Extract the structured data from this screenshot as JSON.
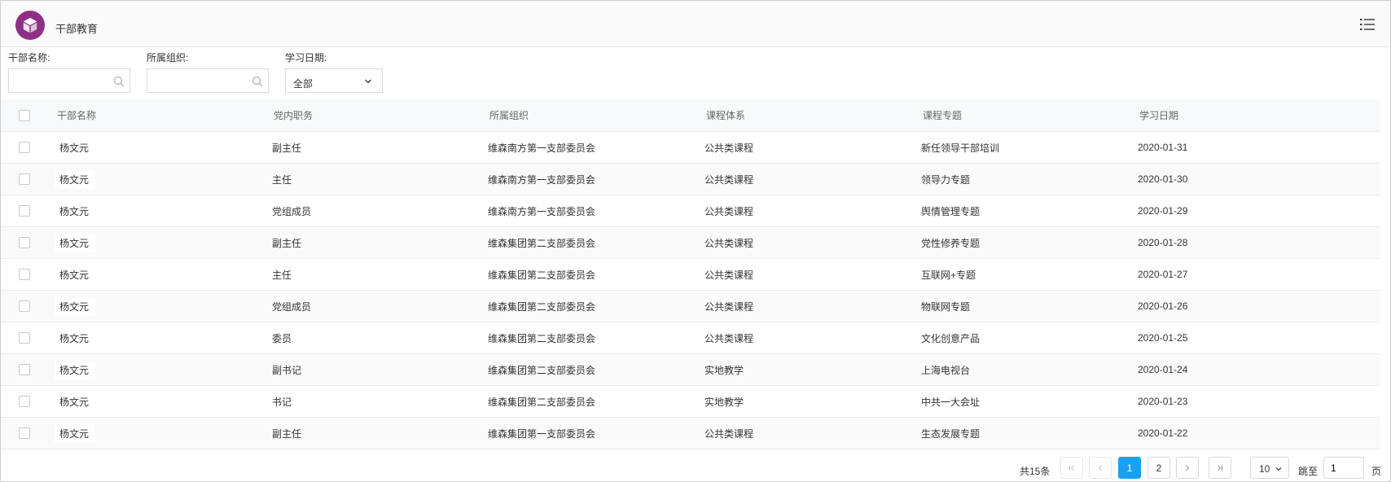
{
  "header": {
    "title": "干部教育",
    "logo_icon": "cube-icon",
    "menu_icon": "list-menu-icon",
    "logo_color": "#8e2f86"
  },
  "filters": {
    "name_label": "干部名称:",
    "name_value": "",
    "org_label": "所属组织:",
    "org_value": "",
    "date_label": "学习日期:",
    "date_selected": "全部"
  },
  "table": {
    "columns": [
      "干部名称",
      "党内职务",
      "所属组织",
      "课程体系",
      "课程专题",
      "学习日期"
    ],
    "rows": [
      [
        "杨文元",
        "副主任",
        "维森南方第一支部委员会",
        "公共类课程",
        "新任领导干部培训",
        "2020-01-31"
      ],
      [
        "杨文元",
        "主任",
        "维森南方第一支部委员会",
        "公共类课程",
        "领导力专题",
        "2020-01-30"
      ],
      [
        "杨文元",
        "党组成员",
        "维森南方第一支部委员会",
        "公共类课程",
        "舆情管理专题",
        "2020-01-29"
      ],
      [
        "杨文元",
        "副主任",
        "维森集团第二支部委员会",
        "公共类课程",
        "党性修养专题",
        "2020-01-28"
      ],
      [
        "杨文元",
        "主任",
        "维森集团第二支部委员会",
        "公共类课程",
        "互联网+专题",
        "2020-01-27"
      ],
      [
        "杨文元",
        "党组成员",
        "维森集团第二支部委员会",
        "公共类课程",
        "物联网专题",
        "2020-01-26"
      ],
      [
        "杨文元",
        "委员",
        "维森集团第二支部委员会",
        "公共类课程",
        "文化创意产品",
        "2020-01-25"
      ],
      [
        "杨文元",
        "副书记",
        "维森集团第二支部委员会",
        "实地教学",
        "上海电视台",
        "2020-01-24"
      ],
      [
        "杨文元",
        "书记",
        "维森集团第二支部委员会",
        "实地教学",
        "中共一大会址",
        "2020-01-23"
      ],
      [
        "杨文元",
        "副主任",
        "维森集团第一支部委员会",
        "公共类课程",
        "生态发展专题",
        "2020-01-22"
      ]
    ]
  },
  "pagination": {
    "total": "共15条",
    "pages": [
      "1",
      "2"
    ],
    "current_page": "1",
    "page_size": "10",
    "jump_label": "跳至",
    "jump_value": "1",
    "page_suffix": "页",
    "accent_color": "#1aa0f0"
  }
}
